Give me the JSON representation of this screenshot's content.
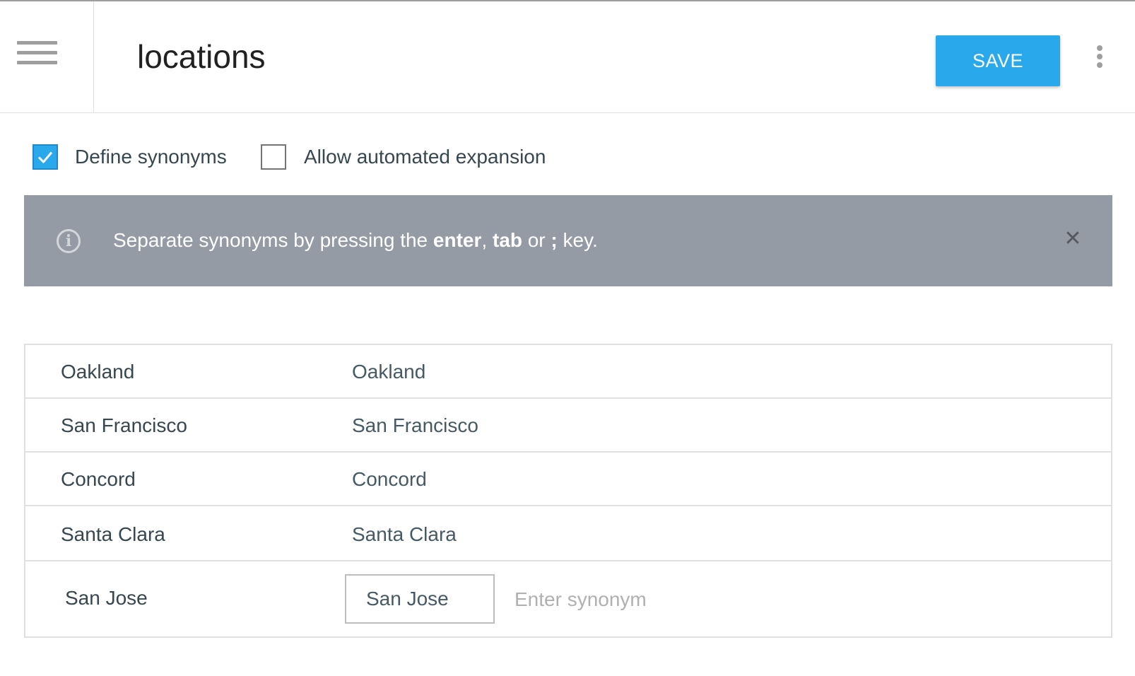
{
  "header": {
    "title": "locations",
    "save_label": "SAVE"
  },
  "options": {
    "define_synonyms": {
      "label": "Define synonyms",
      "checked": true
    },
    "allow_expansion": {
      "label": "Allow automated expansion",
      "checked": false
    }
  },
  "banner": {
    "text_before": "Separate synonyms by pressing the ",
    "key_enter": "enter",
    "sep1": ", ",
    "key_tab": "tab",
    "sep2": " or ",
    "key_semicolon": ";",
    "text_after": " key.",
    "close": "✕"
  },
  "table": {
    "rows": [
      {
        "value": "Oakland",
        "synonym": "Oakland"
      },
      {
        "value": "San Francisco",
        "synonym": "San Francisco"
      },
      {
        "value": "Concord",
        "synonym": "Concord"
      },
      {
        "value": "Santa Clara",
        "synonym": "Santa Clara"
      }
    ],
    "editing_row": {
      "value": "San Jose",
      "chip": "San Jose",
      "placeholder": "Enter synonym"
    }
  },
  "colors": {
    "accent": "#29a8ec",
    "banner": "#959ba4"
  },
  "icons": [
    "menu-icon",
    "more-vert-icon",
    "help-icon",
    "info-icon",
    "close-icon",
    "checkmark-icon"
  ]
}
